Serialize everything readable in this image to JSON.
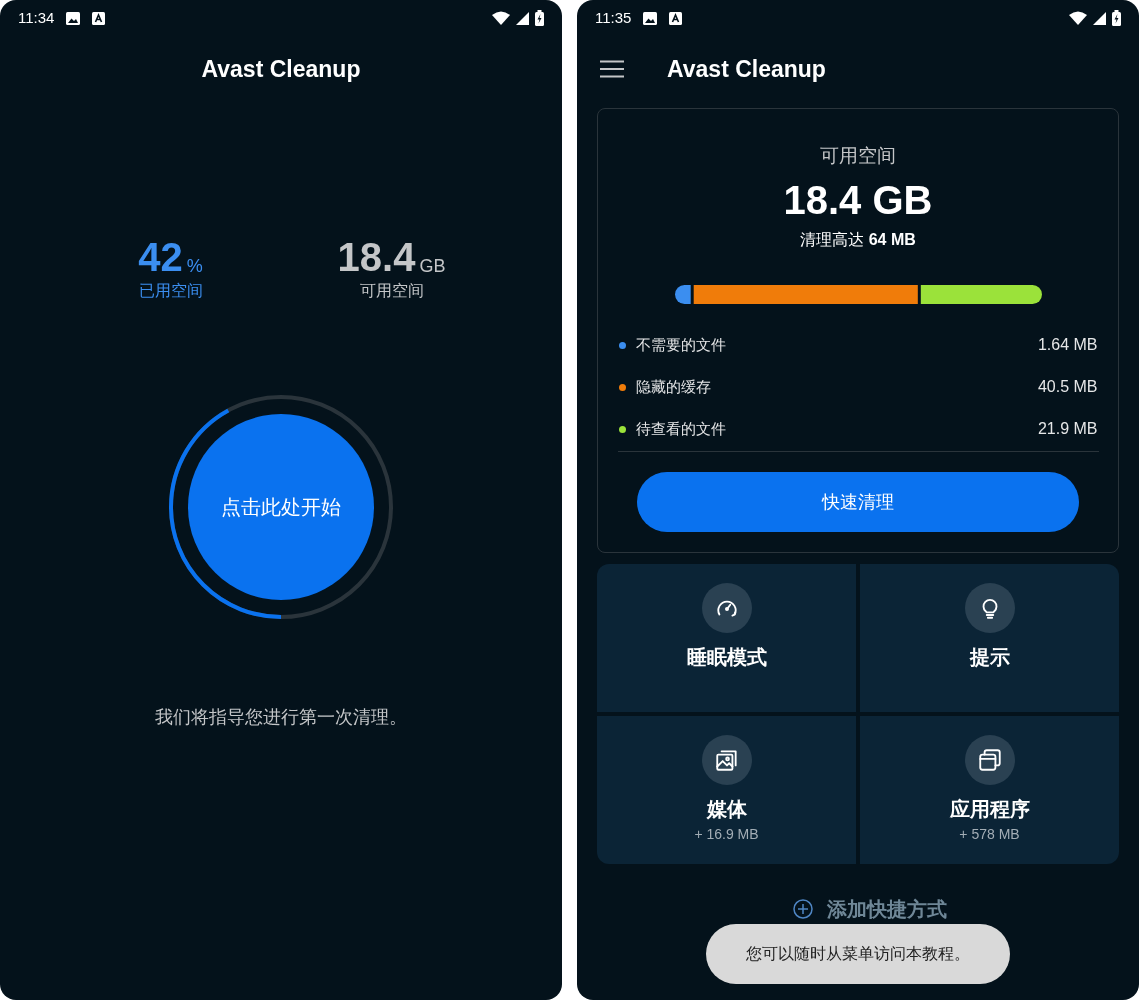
{
  "screens": [
    {
      "status_bar": {
        "time": "11:34"
      },
      "title": "Avast Cleanup",
      "used": {
        "value": "42",
        "unit": "%",
        "label": "已用空间"
      },
      "free": {
        "value": "18.4",
        "unit": "GB",
        "label": "可用空间"
      },
      "start_button": {
        "label": "点击此处开始",
        "level": 0.42
      },
      "hint": "我们将指导您进行第一次清理。"
    },
    {
      "status_bar": {
        "time": "11:35"
      },
      "title": "Avast Cleanup",
      "summary": {
        "label": "可用空间",
        "value": "18.4 GB",
        "cleanable": "清理高达 **64 MB**",
        "items": [
          {
            "label": "不需要的文件",
            "size": "1.64 MB",
            "color": "#3b8ef0"
          },
          {
            "label": "隐藏的缓存",
            "size": "40.5 MB",
            "color": "#f07c0a"
          },
          {
            "label": "待查看的文件",
            "size": "21.9 MB",
            "color": "#9be23a"
          }
        ],
        "button": "快速清理"
      },
      "tiles": [
        {
          "kind": "speed",
          "label": "睡眠模式"
        },
        {
          "kind": "bulb",
          "label": "提示"
        },
        {
          "kind": "media",
          "label": "媒体",
          "detail": "+ 16.9 MB"
        },
        {
          "kind": "apps",
          "label": "应用程序",
          "detail": "+ 578 MB"
        }
      ],
      "add_shortcut": "添加快捷方式",
      "toast": "您可以随时从菜单访问本教程。"
    }
  ]
}
